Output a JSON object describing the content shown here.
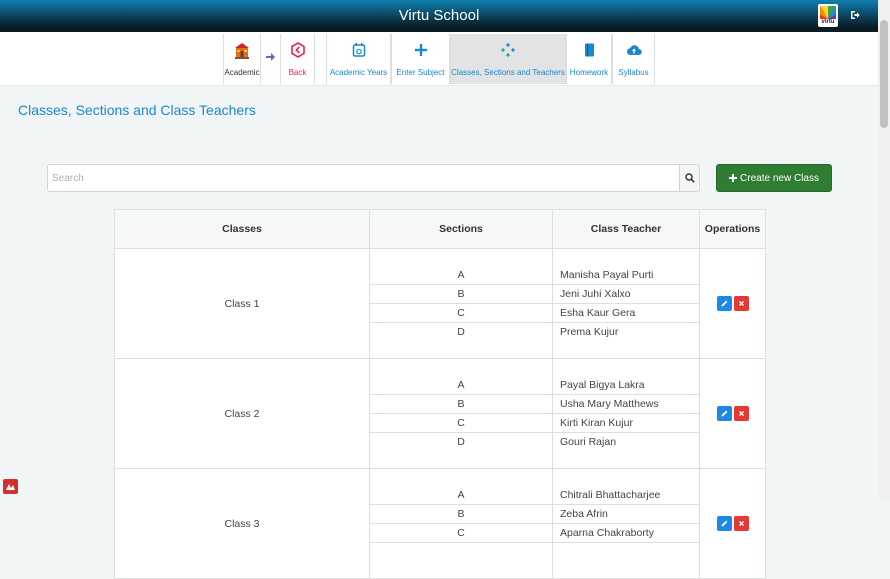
{
  "app": {
    "title": "Virtu School",
    "logo_text": "virtu"
  },
  "icons": {
    "logout": "sign-out-icon",
    "search": "search-icon"
  },
  "nav": {
    "items": [
      {
        "label": "Academic",
        "icon": "school-building-icon"
      },
      {
        "label": "Back",
        "icon": "back-icon"
      },
      {
        "label": "Academic Years",
        "icon": "calendar-icon"
      },
      {
        "label": "Enter Subject",
        "icon": "plus-icon"
      },
      {
        "label": "Classes, Sections and Teachers",
        "icon": "sections-icon",
        "active": true
      },
      {
        "label": "Homework",
        "icon": "book-icon"
      },
      {
        "label": "Syllabus",
        "icon": "cloud-upload-icon"
      }
    ]
  },
  "page": {
    "title": "Classes, Sections and Class Teachers"
  },
  "search": {
    "placeholder": "Search",
    "value": ""
  },
  "create_button": {
    "label": "Create new Class"
  },
  "table": {
    "headers": [
      "Classes",
      "Sections",
      "Class Teacher",
      "Operations"
    ],
    "classes": [
      {
        "name": "Class 1",
        "sections": [
          {
            "section": "A",
            "teacher": "Manisha Payal Purti"
          },
          {
            "section": "B",
            "teacher": "Jeni Juhi Xalxo"
          },
          {
            "section": "C",
            "teacher": "Esha Kaur Gera"
          },
          {
            "section": "D",
            "teacher": "Prema Kujur"
          }
        ]
      },
      {
        "name": "Class 2",
        "sections": [
          {
            "section": "A",
            "teacher": "Payal Bigya Lakra"
          },
          {
            "section": "B",
            "teacher": "Usha Mary Matthews"
          },
          {
            "section": "C",
            "teacher": "Kirti Kiran Kujur"
          },
          {
            "section": "D",
            "teacher": "Gouri Rajan"
          }
        ]
      },
      {
        "name": "Class 3",
        "sections": [
          {
            "section": "A",
            "teacher": "Chitrali Bhattacharjee"
          },
          {
            "section": "B",
            "teacher": "Zeba Afrin"
          },
          {
            "section": "C",
            "teacher": "Aparna Chakraborty"
          },
          {
            "section": "",
            "teacher": ""
          }
        ]
      }
    ]
  },
  "colors": {
    "accent": "#1a88cc",
    "create": "#2e7d32",
    "edit": "#1e88e5",
    "delete": "#e53935",
    "back": "#e91e63"
  }
}
